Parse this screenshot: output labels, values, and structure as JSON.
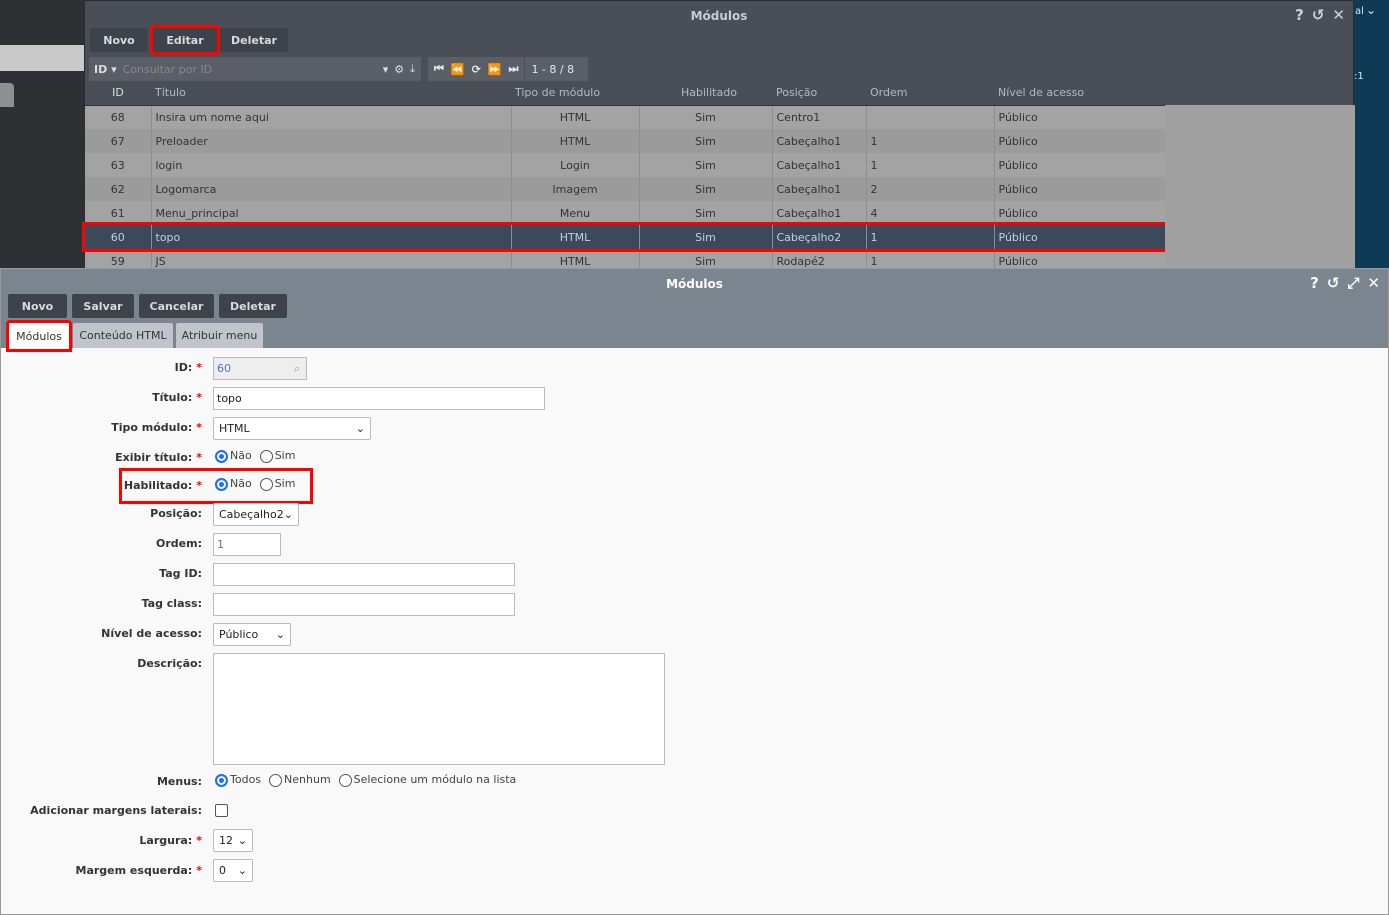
{
  "background": {
    "right_text_1": "al",
    "right_text_2": ":1"
  },
  "list_window": {
    "title": "Módulos",
    "buttons": {
      "new": "Novo",
      "edit": "Editar",
      "delete": "Deletar"
    },
    "search": {
      "field": "ID",
      "placeholder": "Consultar por ID"
    },
    "pager": "1 - 8 / 8",
    "columns": [
      "ID",
      "Título",
      "Tipo de módulo",
      "Habilitado",
      "Posição",
      "Ordem",
      "Nível de acesso"
    ],
    "rows": [
      [
        "68",
        "Insira um nome aqui",
        "HTML",
        "Sim",
        "Centro1",
        "",
        "Público"
      ],
      [
        "67",
        "Preloader",
        "HTML",
        "Sim",
        "Cabeçalho1",
        "1",
        "Público"
      ],
      [
        "63",
        "login",
        "Login",
        "Sim",
        "Cabeçalho1",
        "1",
        "Público"
      ],
      [
        "62",
        "Logomarca",
        "Imagem",
        "Sim",
        "Cabeçalho1",
        "2",
        "Público"
      ],
      [
        "61",
        "Menu_principal",
        "Menu",
        "Sim",
        "Cabeçalho1",
        "4",
        "Público"
      ],
      [
        "60",
        "topo",
        "HTML",
        "Sim",
        "Cabeçalho2",
        "1",
        "Público"
      ],
      [
        "59",
        "JS",
        "HTML",
        "Sim",
        "Rodapé2",
        "1",
        "Público"
      ]
    ],
    "selected_id": "60"
  },
  "form_window": {
    "title": "Módulos",
    "buttons": {
      "new": "Novo",
      "save": "Salvar",
      "cancel": "Cancelar",
      "delete": "Deletar"
    },
    "tabs": [
      "Módulos",
      "Conteúdo HTML",
      "Atribuir menu"
    ],
    "fields": {
      "id": {
        "label": "ID:",
        "value": "60"
      },
      "titulo": {
        "label": "Título:",
        "value": "topo"
      },
      "tipo": {
        "label": "Tipo módulo:",
        "value": "HTML"
      },
      "exibir": {
        "label": "Exibir título:",
        "options": [
          "Não",
          "Sim"
        ],
        "selected": "Não"
      },
      "habilitado": {
        "label": "Habilitado:",
        "options": [
          "Não",
          "Sim"
        ],
        "selected": "Não"
      },
      "posicao": {
        "label": "Posição:",
        "value": "Cabeçalho2"
      },
      "ordem": {
        "label": "Ordem:",
        "value": "1"
      },
      "tagid": {
        "label": "Tag ID:",
        "value": ""
      },
      "tagclass": {
        "label": "Tag class:",
        "value": ""
      },
      "nivel": {
        "label": "Nível de acesso:",
        "value": "Público"
      },
      "descricao": {
        "label": "Descrição:",
        "value": ""
      },
      "menus": {
        "label": "Menus:",
        "options": [
          "Todos",
          "Nenhum",
          "Selecione um módulo na lista"
        ],
        "selected": "Todos"
      },
      "margens": {
        "label": "Adicionar margens laterais:",
        "checked": false
      },
      "largura": {
        "label": "Largura:",
        "value": "12"
      },
      "margem": {
        "label": "Margem esquerda:",
        "value": "0"
      }
    },
    "required_mark": "*"
  },
  "colors": {
    "highlight": "#ff0000",
    "selected_row": "#3a4a5a",
    "radio": "#1a73e8"
  }
}
